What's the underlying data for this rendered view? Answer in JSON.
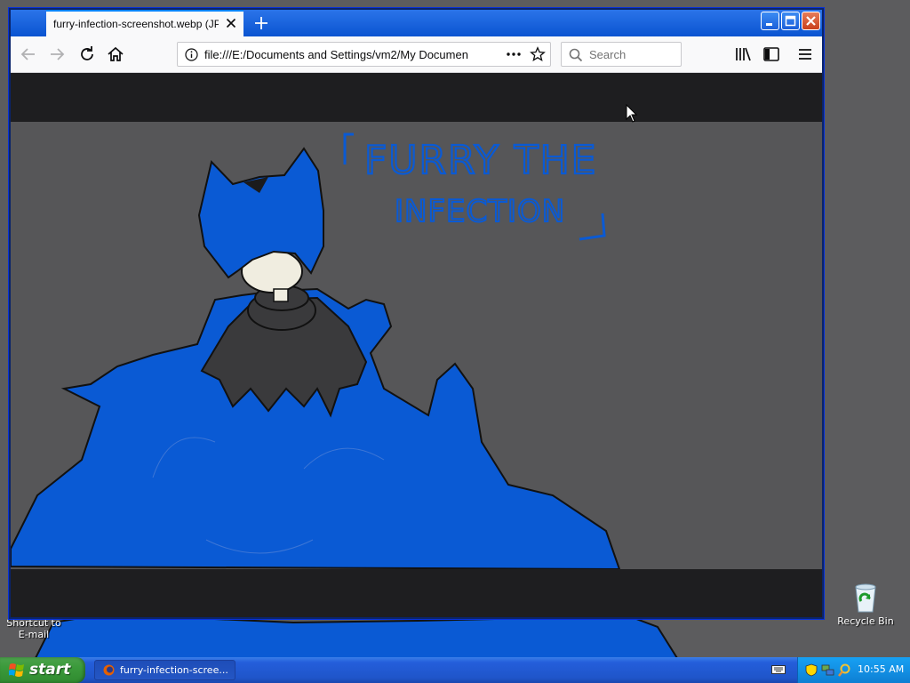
{
  "window": {
    "tab_title": "furry-infection-screenshot.webp (JPEG",
    "url": "file:///E:/Documents and Settings/vm2/My Documen",
    "search_placeholder": "Search"
  },
  "artwork": {
    "title_line1": "FURRY THE",
    "title_line2": "INFECTION",
    "accent_blue": "#0a5ad4",
    "background_gray": "#565658"
  },
  "desktop": {
    "icons": [
      {
        "label_line1": "Shortcut to",
        "label_line2": "E-mail"
      },
      {
        "label_line1": "Recycle Bin"
      }
    ]
  },
  "taskbar": {
    "start_label": "start",
    "task_label": "furry-infection-scree...",
    "clock": "10:55 AM"
  }
}
